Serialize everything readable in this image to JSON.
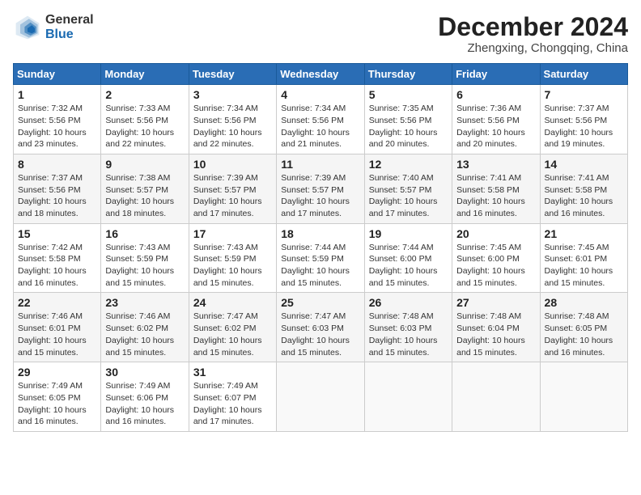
{
  "logo": {
    "general": "General",
    "blue": "Blue"
  },
  "title": "December 2024",
  "subtitle": "Zhengxing, Chongqing, China",
  "headers": [
    "Sunday",
    "Monday",
    "Tuesday",
    "Wednesday",
    "Thursday",
    "Friday",
    "Saturday"
  ],
  "weeks": [
    [
      {
        "day": "1",
        "info": "Sunrise: 7:32 AM\nSunset: 5:56 PM\nDaylight: 10 hours\nand 23 minutes."
      },
      {
        "day": "2",
        "info": "Sunrise: 7:33 AM\nSunset: 5:56 PM\nDaylight: 10 hours\nand 22 minutes."
      },
      {
        "day": "3",
        "info": "Sunrise: 7:34 AM\nSunset: 5:56 PM\nDaylight: 10 hours\nand 22 minutes."
      },
      {
        "day": "4",
        "info": "Sunrise: 7:34 AM\nSunset: 5:56 PM\nDaylight: 10 hours\nand 21 minutes."
      },
      {
        "day": "5",
        "info": "Sunrise: 7:35 AM\nSunset: 5:56 PM\nDaylight: 10 hours\nand 20 minutes."
      },
      {
        "day": "6",
        "info": "Sunrise: 7:36 AM\nSunset: 5:56 PM\nDaylight: 10 hours\nand 20 minutes."
      },
      {
        "day": "7",
        "info": "Sunrise: 7:37 AM\nSunset: 5:56 PM\nDaylight: 10 hours\nand 19 minutes."
      }
    ],
    [
      {
        "day": "8",
        "info": "Sunrise: 7:37 AM\nSunset: 5:56 PM\nDaylight: 10 hours\nand 18 minutes."
      },
      {
        "day": "9",
        "info": "Sunrise: 7:38 AM\nSunset: 5:57 PM\nDaylight: 10 hours\nand 18 minutes."
      },
      {
        "day": "10",
        "info": "Sunrise: 7:39 AM\nSunset: 5:57 PM\nDaylight: 10 hours\nand 17 minutes."
      },
      {
        "day": "11",
        "info": "Sunrise: 7:39 AM\nSunset: 5:57 PM\nDaylight: 10 hours\nand 17 minutes."
      },
      {
        "day": "12",
        "info": "Sunrise: 7:40 AM\nSunset: 5:57 PM\nDaylight: 10 hours\nand 17 minutes."
      },
      {
        "day": "13",
        "info": "Sunrise: 7:41 AM\nSunset: 5:58 PM\nDaylight: 10 hours\nand 16 minutes."
      },
      {
        "day": "14",
        "info": "Sunrise: 7:41 AM\nSunset: 5:58 PM\nDaylight: 10 hours\nand 16 minutes."
      }
    ],
    [
      {
        "day": "15",
        "info": "Sunrise: 7:42 AM\nSunset: 5:58 PM\nDaylight: 10 hours\nand 16 minutes."
      },
      {
        "day": "16",
        "info": "Sunrise: 7:43 AM\nSunset: 5:59 PM\nDaylight: 10 hours\nand 15 minutes."
      },
      {
        "day": "17",
        "info": "Sunrise: 7:43 AM\nSunset: 5:59 PM\nDaylight: 10 hours\nand 15 minutes."
      },
      {
        "day": "18",
        "info": "Sunrise: 7:44 AM\nSunset: 5:59 PM\nDaylight: 10 hours\nand 15 minutes."
      },
      {
        "day": "19",
        "info": "Sunrise: 7:44 AM\nSunset: 6:00 PM\nDaylight: 10 hours\nand 15 minutes."
      },
      {
        "day": "20",
        "info": "Sunrise: 7:45 AM\nSunset: 6:00 PM\nDaylight: 10 hours\nand 15 minutes."
      },
      {
        "day": "21",
        "info": "Sunrise: 7:45 AM\nSunset: 6:01 PM\nDaylight: 10 hours\nand 15 minutes."
      }
    ],
    [
      {
        "day": "22",
        "info": "Sunrise: 7:46 AM\nSunset: 6:01 PM\nDaylight: 10 hours\nand 15 minutes."
      },
      {
        "day": "23",
        "info": "Sunrise: 7:46 AM\nSunset: 6:02 PM\nDaylight: 10 hours\nand 15 minutes."
      },
      {
        "day": "24",
        "info": "Sunrise: 7:47 AM\nSunset: 6:02 PM\nDaylight: 10 hours\nand 15 minutes."
      },
      {
        "day": "25",
        "info": "Sunrise: 7:47 AM\nSunset: 6:03 PM\nDaylight: 10 hours\nand 15 minutes."
      },
      {
        "day": "26",
        "info": "Sunrise: 7:48 AM\nSunset: 6:03 PM\nDaylight: 10 hours\nand 15 minutes."
      },
      {
        "day": "27",
        "info": "Sunrise: 7:48 AM\nSunset: 6:04 PM\nDaylight: 10 hours\nand 15 minutes."
      },
      {
        "day": "28",
        "info": "Sunrise: 7:48 AM\nSunset: 6:05 PM\nDaylight: 10 hours\nand 16 minutes."
      }
    ],
    [
      {
        "day": "29",
        "info": "Sunrise: 7:49 AM\nSunset: 6:05 PM\nDaylight: 10 hours\nand 16 minutes."
      },
      {
        "day": "30",
        "info": "Sunrise: 7:49 AM\nSunset: 6:06 PM\nDaylight: 10 hours\nand 16 minutes."
      },
      {
        "day": "31",
        "info": "Sunrise: 7:49 AM\nSunset: 6:07 PM\nDaylight: 10 hours\nand 17 minutes."
      },
      null,
      null,
      null,
      null
    ]
  ]
}
